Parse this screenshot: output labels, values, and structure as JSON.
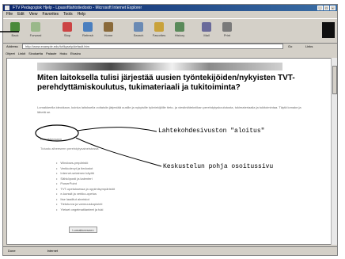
{
  "window": {
    "title": "FTV Pedagogisk Hjelp - Lipasoftlahtotiedosto - Microsoft Internet Explorer"
  },
  "menu": [
    "File",
    "Edit",
    "View",
    "Favorites",
    "Tools",
    "Help"
  ],
  "toolbar": [
    "Back",
    "Forward",
    "Stop",
    "Refresh",
    "Home",
    "Search",
    "Favorites",
    "History",
    "Mail",
    "Print"
  ],
  "address": {
    "label": "Address",
    "url": "http://www.example.edu/tvt/kysely/default.htm",
    "go": "Go",
    "links": "Links"
  },
  "linksbar": [
    "Ohjeet",
    "Linkit",
    "Sivukartta",
    "Palaute",
    "Haku",
    "Etusivu"
  ],
  "page": {
    "heading": "Miten laitoksella tulisi järjestää uusien työntekijöiden/nykyisten TVT-perehdyttämiskoulutus, tukimateriaali ja tukitoiminta?",
    "paragraph": "Lomakkeella ideoidaan, kuinka laitoksella voitaisiin järjestää uusille ja nykyisille työntekijöille tieto- ja viestintätekniikan perehdytyskoulutusta, tukimateriaalia ja tukitoimintaa. Täytä lomake ja lähetä se.",
    "form_link": "Lomakkeeseen",
    "caption": "Tutustu aiheeseen perehdytysaineistossa",
    "bullets": [
      "Windows-ympäristö",
      "Verkkolevyt ja tiedostot",
      "Internet-selaimen käyttö",
      "Sähköposti ja kalenteri",
      "PowerPoint",
      "TVT-opetuksessa ja oppimisympäristöt",
      "e-kurssit ja verkko-opetus",
      "Itse laaditut aineistot",
      "Tietoturva ja varmuuskopiointi",
      "Yleiset ongelmatilanteet ja tuki"
    ],
    "bottom_button": "Lomakkeeseen"
  },
  "annotations": {
    "first": "Lahtekohdesivuston \"aloitus\"",
    "second": "Keskustelun pohja osoitussivu"
  },
  "statusbar": [
    "Done",
    "Internet"
  ]
}
